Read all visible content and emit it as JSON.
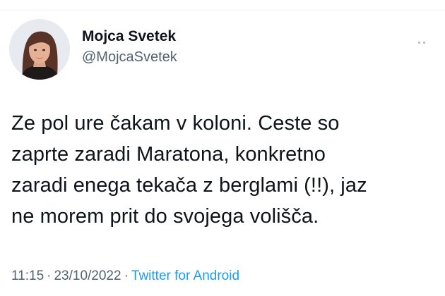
{
  "tweet": {
    "display_name": "Mojca Svetek",
    "handle": "@MojcaSvetek",
    "text": "Ze pol ure čakam v koloni. Ceste so\nzaprte zaradi Maratona, konkretno\nzaradi enega tekača z berglami (!!), jaz\nne morem prit do svojega volišča.",
    "time": "11:15",
    "date": "23/10/2022",
    "separator": "·",
    "source": "Twitter for Android"
  },
  "icons": {
    "more": "more-horizontal-icon",
    "avatar": "profile-photo"
  },
  "colors": {
    "text_primary": "#0f1419",
    "text_secondary": "#536471",
    "link": "#1d9bf0"
  }
}
